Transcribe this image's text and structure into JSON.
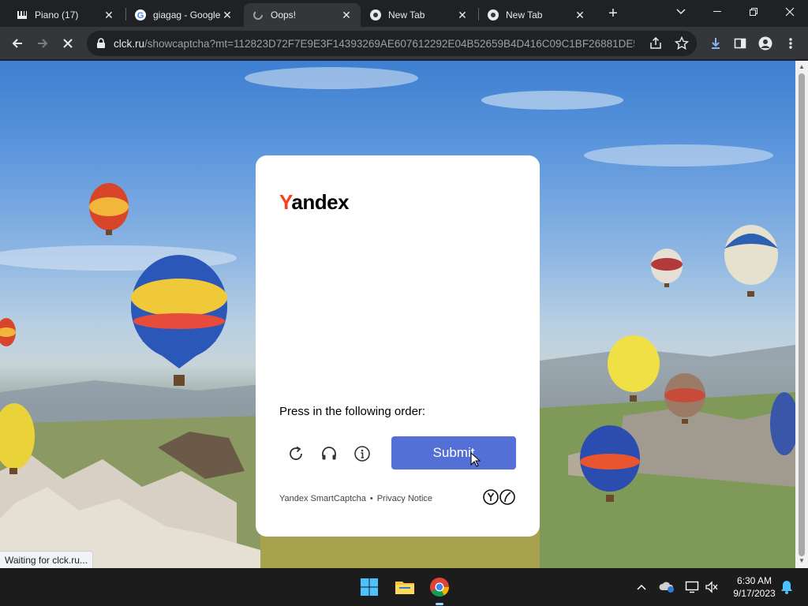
{
  "browser": {
    "tabs": [
      {
        "label": "Piano (17)",
        "icon": "piano-tab-icon",
        "active": false
      },
      {
        "label": "giagag - Google",
        "icon": "google-icon",
        "active": false
      },
      {
        "label": "Oops!",
        "icon": "loading-icon",
        "active": true
      },
      {
        "label": "New Tab",
        "icon": "chrome-icon",
        "active": false
      },
      {
        "label": "New Tab",
        "icon": "chrome-icon",
        "active": false
      }
    ],
    "url_host": "clck.ru",
    "url_rest": "/showcaptcha?mt=112823D72F7E9E3F14393269AE607612292E04B52659B4D416C09C1BF26881DE5...",
    "status_text": "Waiting for clck.ru..."
  },
  "captcha": {
    "logo_first": "Y",
    "logo_rest": "andex",
    "instruction": "Press in the following order:",
    "submit_label": "Submit",
    "footer_brand": "Yandex SmartCaptcha",
    "footer_separator": "•",
    "footer_privacy": "Privacy Notice",
    "colors": {
      "submit": "#5470d6",
      "logo_accent": "#fc3f1d"
    }
  },
  "taskbar": {
    "time": "6:30 AM",
    "date": "9/17/2023"
  }
}
